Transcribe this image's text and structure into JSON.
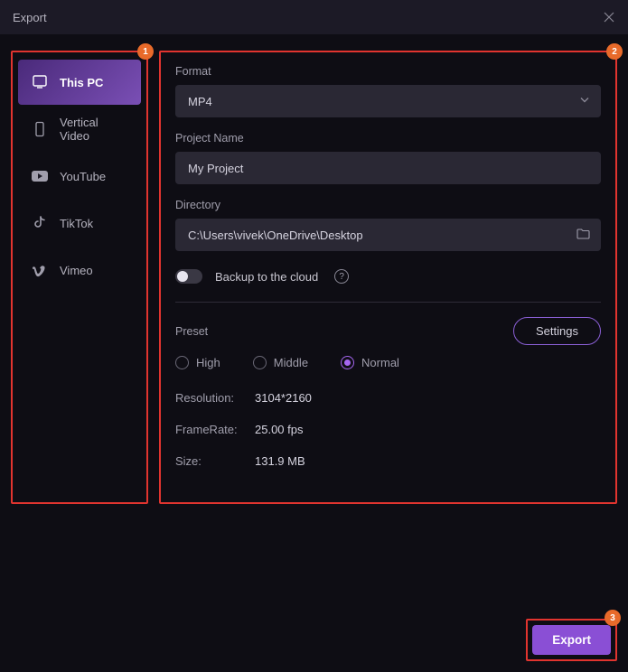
{
  "window": {
    "title": "Export"
  },
  "badges": {
    "sidebar": "1",
    "main": "2",
    "export": "3"
  },
  "sidebar": {
    "items": [
      {
        "label": "This PC",
        "icon": "monitor-icon",
        "active": true
      },
      {
        "label": "Vertical Video",
        "icon": "phone-icon",
        "active": false
      },
      {
        "label": "YouTube",
        "icon": "youtube-icon",
        "active": false
      },
      {
        "label": "TikTok",
        "icon": "tiktok-icon",
        "active": false
      },
      {
        "label": "Vimeo",
        "icon": "vimeo-icon",
        "active": false
      }
    ]
  },
  "main": {
    "format_label": "Format",
    "format_value": "MP4",
    "project_label": "Project Name",
    "project_value": "My Project",
    "directory_label": "Directory",
    "directory_value": "C:\\Users\\vivek\\OneDrive\\Desktop",
    "backup_label": "Backup to the cloud",
    "preset_label": "Preset",
    "settings_label": "Settings",
    "radios": [
      {
        "label": "High",
        "selected": false
      },
      {
        "label": "Middle",
        "selected": false
      },
      {
        "label": "Normal",
        "selected": true
      }
    ],
    "info": {
      "resolution_label": "Resolution:",
      "resolution_value": "3104*2160",
      "framerate_label": "FrameRate:",
      "framerate_value": "25.00 fps",
      "size_label": "Size:",
      "size_value": "131.9 MB"
    }
  },
  "export_label": "Export"
}
